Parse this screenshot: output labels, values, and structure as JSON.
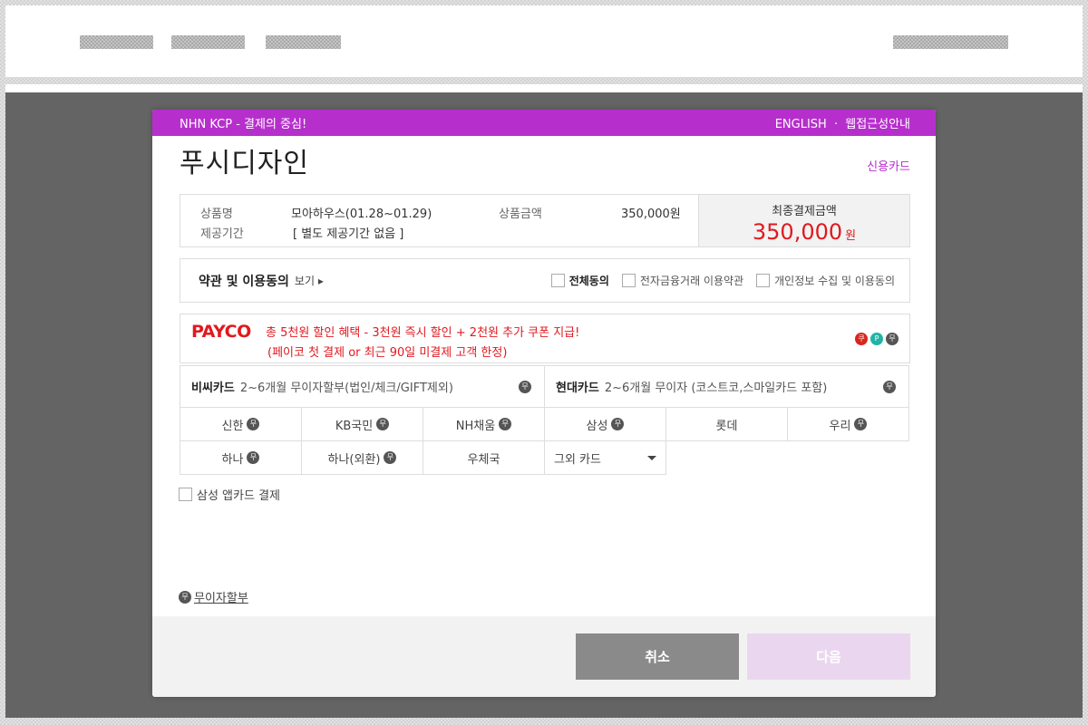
{
  "modal": {
    "brand": "NHN KCP - 결제의 중심!",
    "english_link": "ENGLISH",
    "separator": "·",
    "accessibility_link": "웹접근성안내",
    "merchant_name": "푸시디자인",
    "pay_method": "신용카드"
  },
  "summary": {
    "product_label": "상품명",
    "product_value": "모아하우스(01.28~01.29)",
    "period_label": "제공기간",
    "period_value": "[ 별도 제공기간 없음 ]",
    "amount_label": "상품금액",
    "amount_value": "350,000원",
    "final_label": "최종결제금액",
    "final_amount": "350,000",
    "final_unit": "원"
  },
  "terms": {
    "title": "약관 및 이용동의",
    "view": "보기 ▸",
    "agree_all": "전체동의",
    "agree_efinance": "전자금융거래 이용약관",
    "agree_privacy": "개인정보 수집 및 이용동의"
  },
  "payco": {
    "logo": "PAYCO",
    "line1": "총 5천원 할인 혜택 - 3천원 즉시 할인 + 2천원 추가 쿠폰 지급!",
    "line2": "(페이코 첫 결제 or 최근 90일 미결제 고객 한정)",
    "badge_coupon": "쿠",
    "badge_point": "P",
    "badge_free": "무"
  },
  "promos": [
    {
      "name": "비씨카드",
      "desc": "2~6개월 무이자할부(법인/체크/GIFT제외)",
      "badge": "무"
    },
    {
      "name": "현대카드",
      "desc": "2~6개월 무이자 (코스트코,스마일카드 포함)",
      "badge": "무"
    }
  ],
  "cards": {
    "row1": [
      "신한",
      "KB국민",
      "NH채움",
      "삼성",
      "롯데",
      "우리"
    ],
    "row2": [
      "하나",
      "하나(외환)",
      "우체국"
    ],
    "badge": "무",
    "other_select": "그외 카드"
  },
  "appcard_label": "삼성 앱카드 결제",
  "installment": {
    "badge": "무",
    "label": "무이자할부"
  },
  "buttons": {
    "cancel": "취소",
    "next": "다음"
  },
  "colors": {
    "accent": "#b62fcc",
    "price": "#e0191f",
    "next_disabled": "#ead7ef"
  }
}
